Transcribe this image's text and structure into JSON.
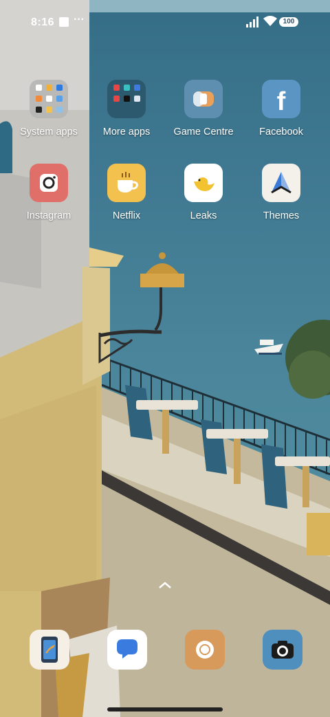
{
  "status_bar": {
    "time": "8:16",
    "more": "···",
    "battery": "100"
  },
  "apps": [
    {
      "label": "System apps",
      "icon": "folder-icon"
    },
    {
      "label": "More apps",
      "icon": "folder-icon"
    },
    {
      "label": "Game Centre",
      "icon": "game-centre-icon"
    },
    {
      "label": "Facebook",
      "icon": "facebook-icon"
    },
    {
      "label": "Instagram",
      "icon": "instagram-icon"
    },
    {
      "label": "Netflix",
      "icon": "netflix-icon"
    },
    {
      "label": "Leaks",
      "icon": "leaks-icon"
    },
    {
      "label": "Themes",
      "icon": "themes-icon"
    }
  ],
  "dock": [
    {
      "icon": "phone-icon"
    },
    {
      "icon": "messages-icon"
    },
    {
      "icon": "browser-icon"
    },
    {
      "icon": "camera-icon"
    }
  ],
  "colors": {
    "sky": "#3f7b93",
    "sea": "#4b879b",
    "wall": "#d3c494",
    "building": "#c9c7c3"
  }
}
